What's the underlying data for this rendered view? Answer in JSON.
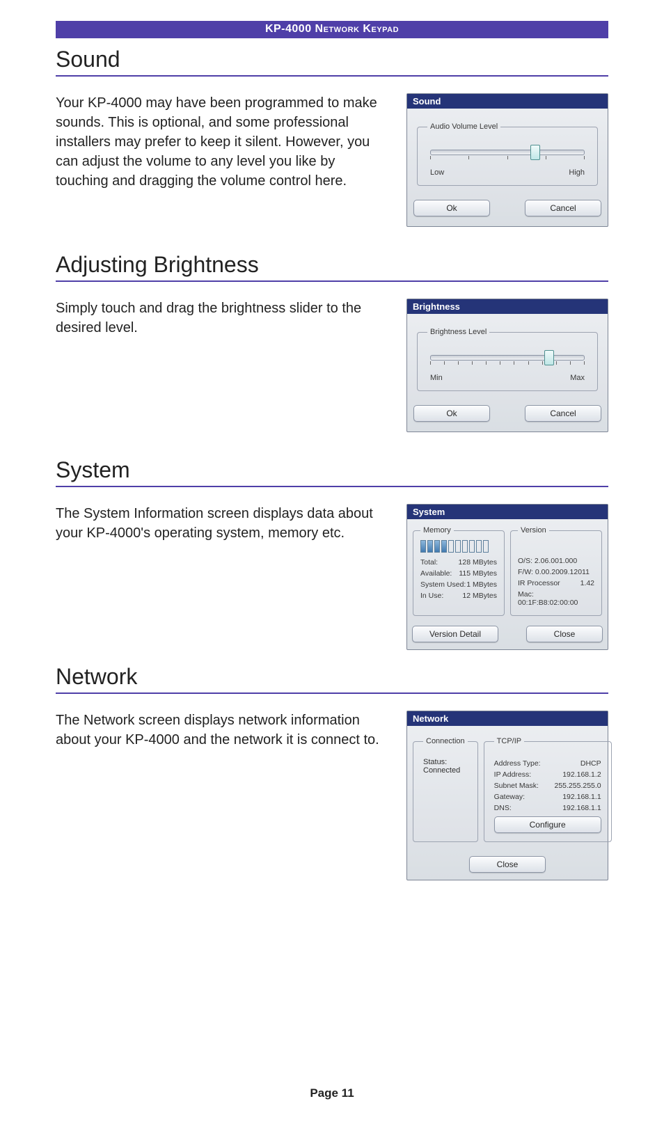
{
  "header": {
    "banner": "KP-4000 Network Keypad"
  },
  "sections": {
    "sound": {
      "title": "Sound",
      "body": "Your KP-4000 may have been programmed to make sounds. This is optional, and some professional installers may prefer to keep it silent. However, you can adjust the volume to any level you like by touching and dragging the volume control here."
    },
    "brightness": {
      "title": "Adjusting Brightness",
      "body": "Simply touch and drag the brightness slider to the desired level."
    },
    "system": {
      "title": "System",
      "body": "The System Information screen displays data about your KP-4000's operating system, memory etc."
    },
    "network": {
      "title": "Network",
      "body": "The Network screen displays network information about your KP-4000 and the network it is connect to."
    }
  },
  "shot_sound": {
    "title": "Sound",
    "group": "Audio Volume Level",
    "low": "Low",
    "high": "High",
    "ok": "Ok",
    "cancel": "Cancel"
  },
  "shot_brightness": {
    "title": "Brightness",
    "group": "Brightness Level",
    "min": "Min",
    "max": "Max",
    "ok": "Ok",
    "cancel": "Cancel"
  },
  "shot_system": {
    "title": "System",
    "memory_legend": "Memory",
    "version_legend": "Version",
    "mem": {
      "total_l": "Total:",
      "total_v": "128 MBytes",
      "avail_l": "Available:",
      "avail_v": "115 MBytes",
      "sys_l": "System Used:",
      "sys_v": "1   MBytes",
      "inuse_l": "In Use:",
      "inuse_v": "12   MBytes"
    },
    "ver": {
      "os": "O/S: 2.06.001.000",
      "fw": "F/W: 0.00.2009.12011",
      "ir_l": "IR Processor",
      "ir_v": "1.42",
      "mac": "Mac: 00:1F:B8:02:00:00"
    },
    "version_detail": "Version Detail",
    "close": "Close"
  },
  "shot_network": {
    "title": "Network",
    "conn_legend": "Connection",
    "status_l": "Status:",
    "status_v": "Connected",
    "tcpip_legend": "TCP/IP",
    "tcpip": {
      "addr_type_l": "Address Type:",
      "addr_type_v": "DHCP",
      "ip_l": "IP Address:",
      "ip_v": "192.168.1.2",
      "mask_l": "Subnet Mask:",
      "mask_v": "255.255.255.0",
      "gw_l": "Gateway:",
      "gw_v": "192.168.1.1",
      "dns_l": "DNS:",
      "dns_v": "192.168.1.1"
    },
    "configure": "Configure",
    "close": "Close"
  },
  "footer": {
    "page": "Page 11"
  }
}
